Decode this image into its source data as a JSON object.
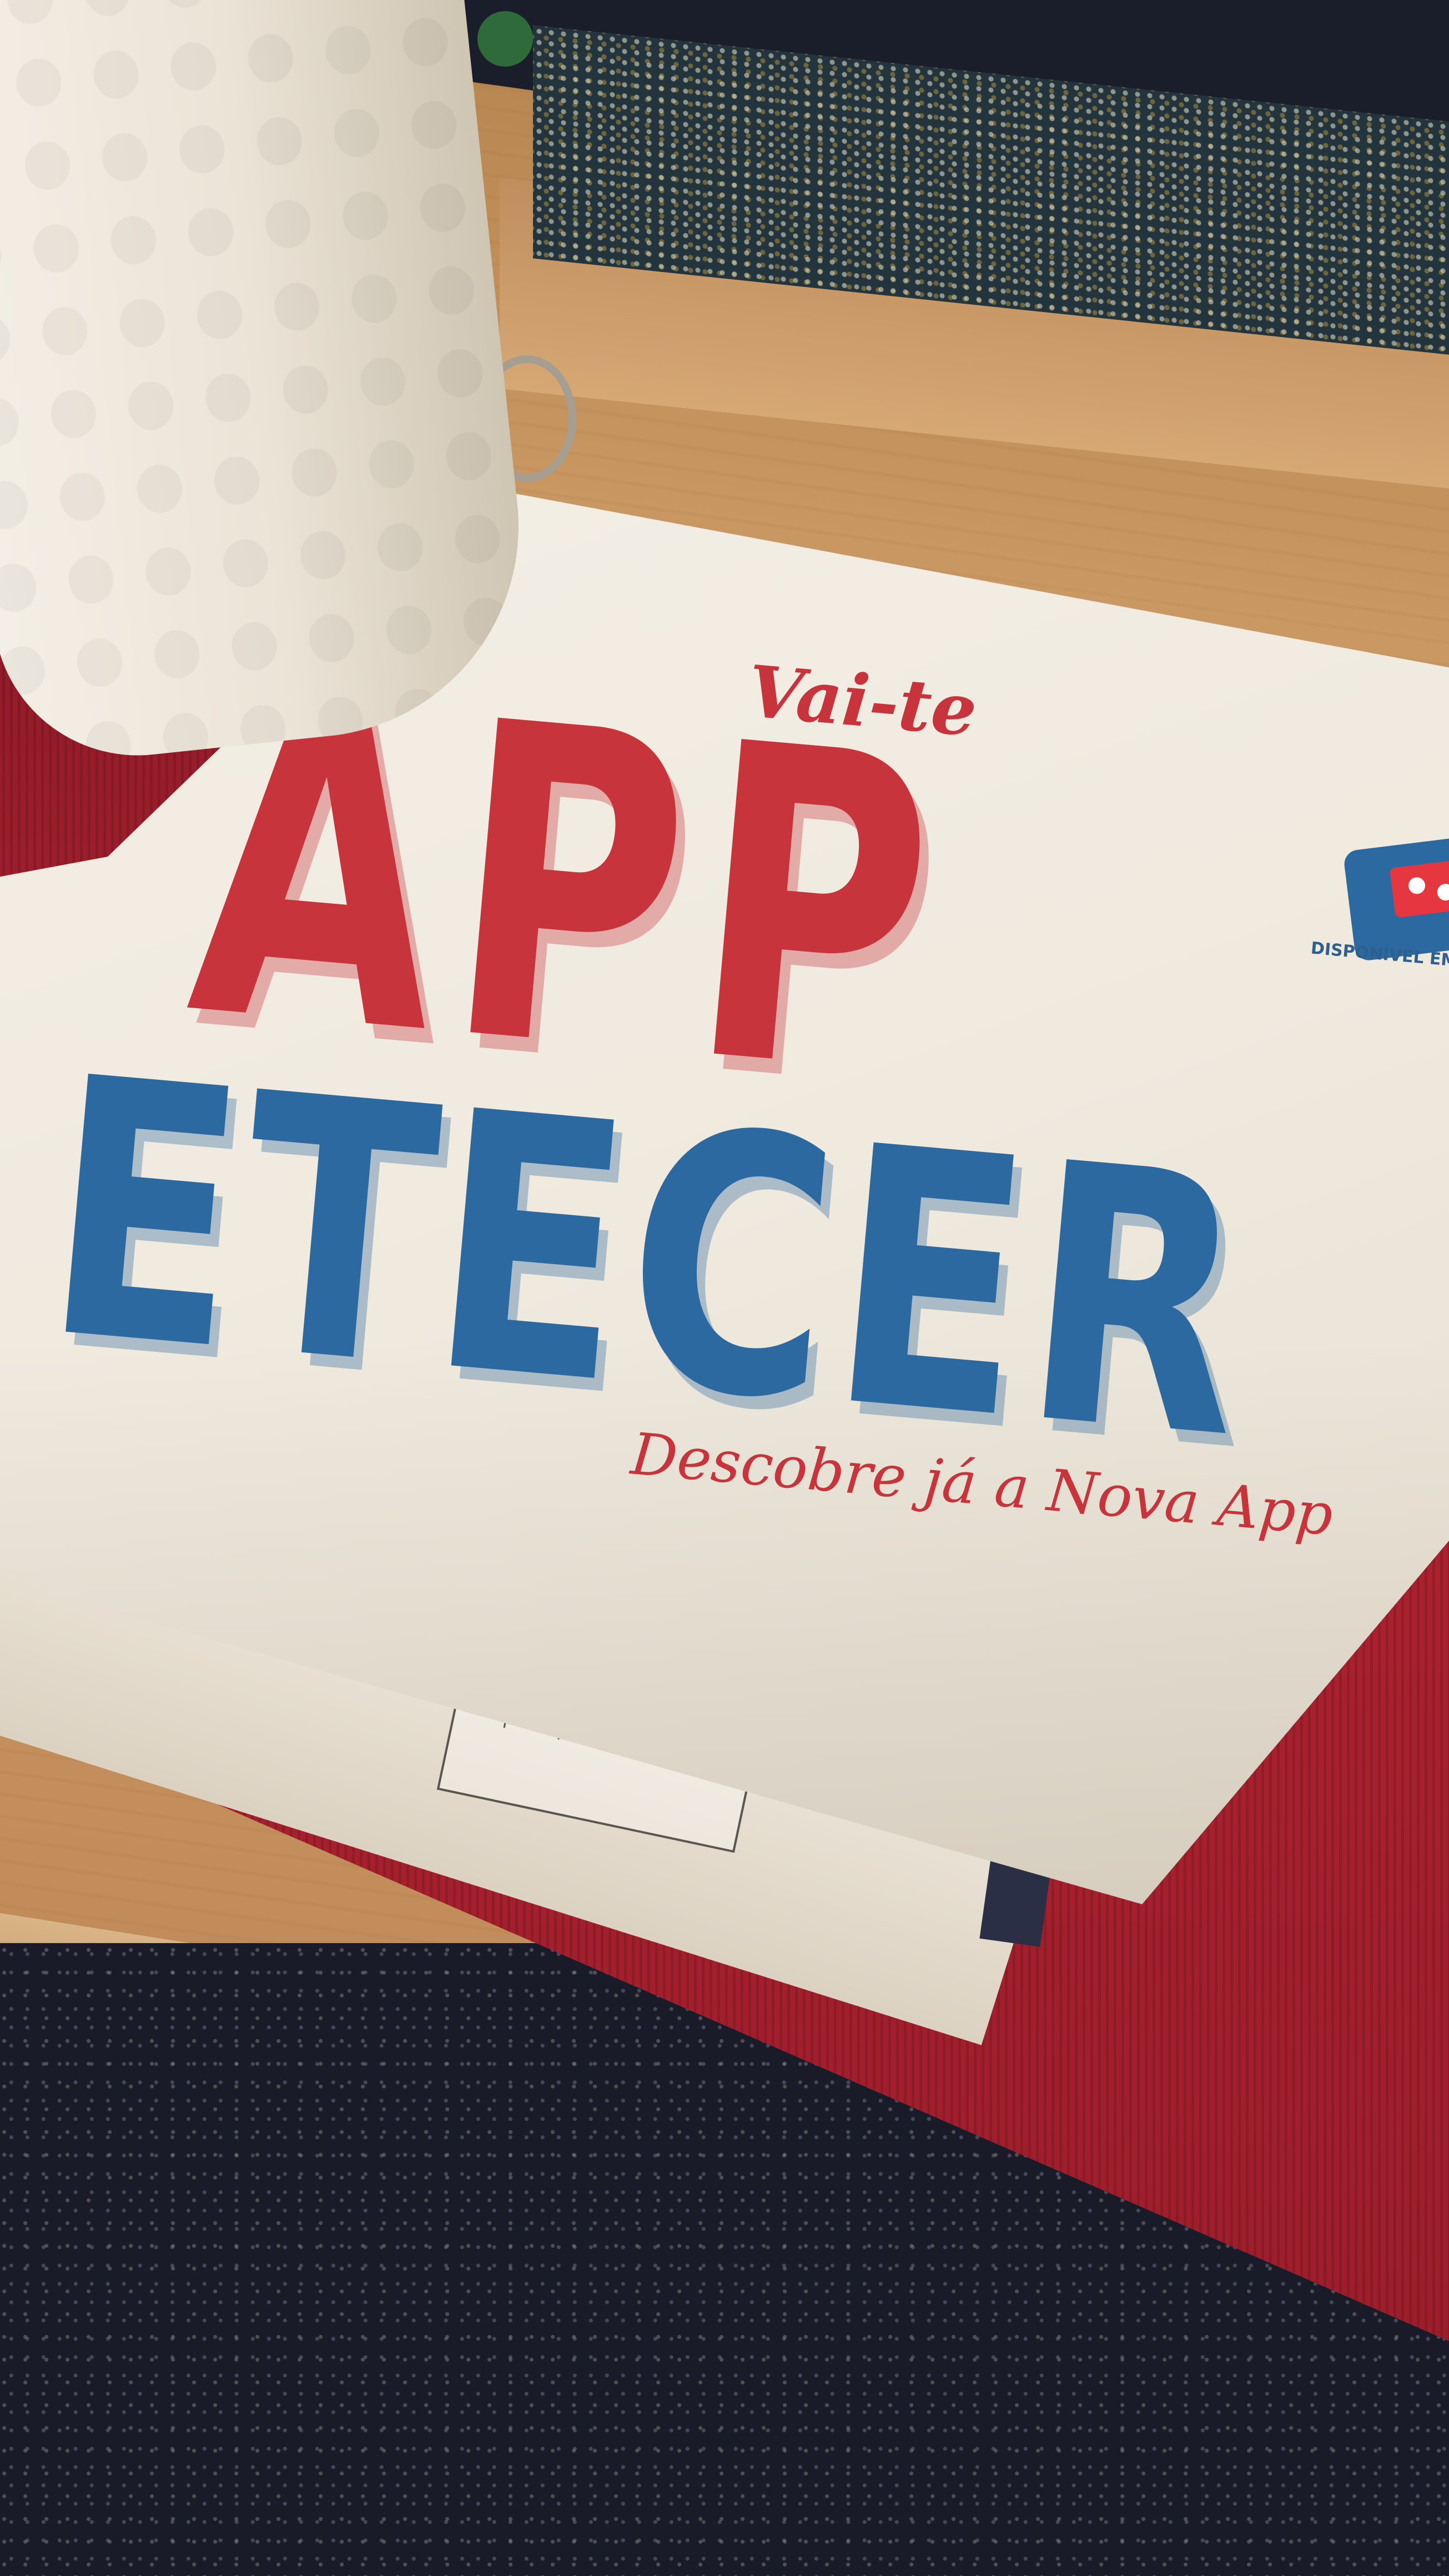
{
  "box": {
    "headline_small": "Vai-te",
    "headline_top": "APP",
    "headline_bottom": "ETECER",
    "tagline": "Descobre já a Nova App",
    "badge": "DISPONÍVEL EM"
  },
  "colors": {
    "red_print": "#c8343b",
    "blue_print": "#2d69a1",
    "placemat": "#a51f2d",
    "cardboard": "#f0eadf"
  },
  "objects": [
    "paper-towel-roll",
    "pizza-box",
    "red-placemat",
    "wooden-table",
    "carpet"
  ]
}
